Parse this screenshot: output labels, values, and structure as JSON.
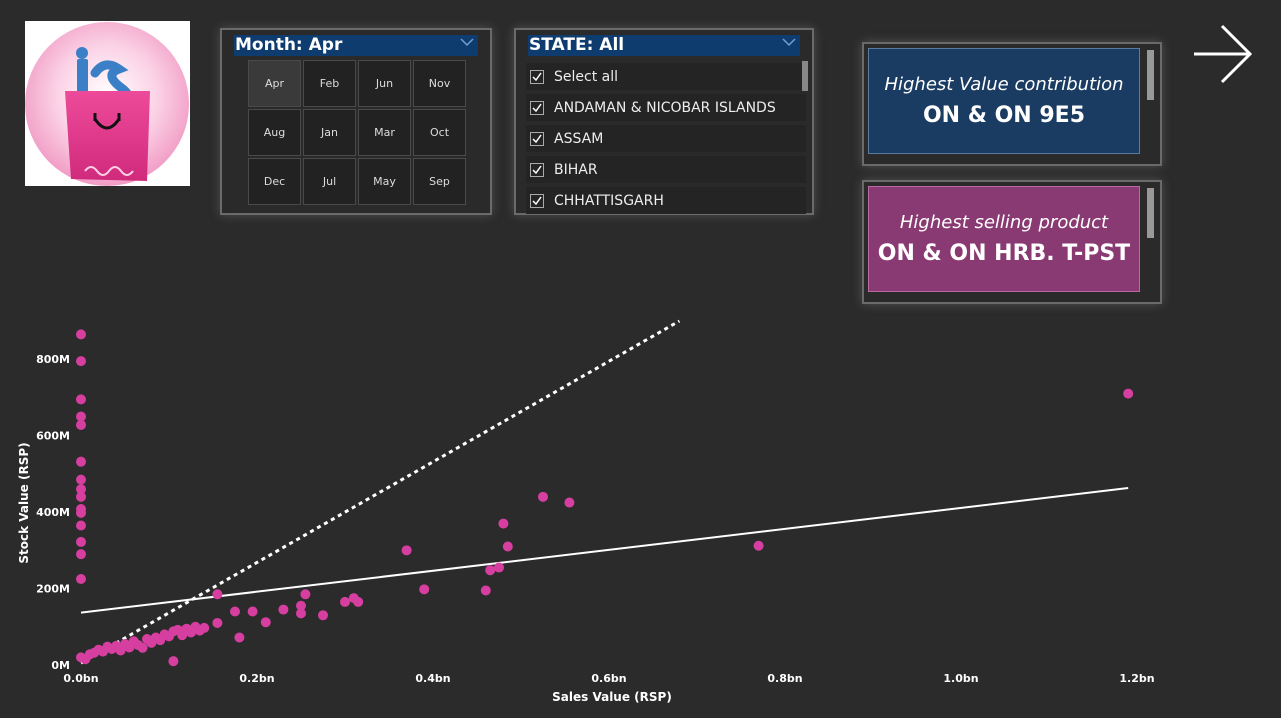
{
  "month_slicer": {
    "title": "Month: Apr",
    "months": [
      "Apr",
      "Feb",
      "Jun",
      "Nov",
      "Aug",
      "Jan",
      "Mar",
      "Oct",
      "Dec",
      "Jul",
      "May",
      "Sep"
    ],
    "selected": "Apr"
  },
  "state_slicer": {
    "title": "STATE: All",
    "items": [
      "Select all",
      "ANDAMAN & NICOBAR ISLANDS",
      "ASSAM",
      "BIHAR",
      "CHHATTISGARH"
    ]
  },
  "cards": {
    "value_title": "Highest Value contribution",
    "value_text": "ON & ON 9E5",
    "product_title": "Highest selling product",
    "product_text": "ON & ON HRB. T-PST"
  },
  "icons": {
    "logo": "shopping-bag-logo",
    "next": "arrow-right-icon",
    "dropdown": "chevron-down-icon",
    "check": "check-icon"
  },
  "colors": {
    "accent_blue": "#0f3c6e",
    "card_blue": "#1b3c62",
    "card_magenta": "#8a3a72",
    "point": "#d63fa0",
    "background": "#2b2b2b"
  },
  "chart_data": {
    "type": "scatter",
    "xlabel": "Sales Value (RSP)",
    "ylabel": "Stock Value (RSP)",
    "xlim": [
      0,
      1.2
    ],
    "ylim": [
      0,
      900
    ],
    "x_ticks": [
      0,
      0.2,
      0.4,
      0.6,
      0.8,
      1.0,
      1.2
    ],
    "x_tick_labels": [
      "0.0bn",
      "0.2bn",
      "0.4bn",
      "0.6bn",
      "0.8bn",
      "1.0bn",
      "1.2bn"
    ],
    "y_ticks": [
      0,
      200,
      400,
      600,
      800
    ],
    "y_tick_labels": [
      "0M",
      "200M",
      "400M",
      "600M",
      "800M"
    ],
    "grid": false,
    "points": [
      [
        0.0,
        865
      ],
      [
        0.0,
        795
      ],
      [
        0.0,
        695
      ],
      [
        0.0,
        650
      ],
      [
        0.0,
        628
      ],
      [
        0.0,
        532
      ],
      [
        0.0,
        485
      ],
      [
        0.0,
        460
      ],
      [
        0.0,
        440
      ],
      [
        0.0,
        408
      ],
      [
        0.0,
        398
      ],
      [
        0.0,
        365
      ],
      [
        0.0,
        322
      ],
      [
        0.0,
        290
      ],
      [
        0.0,
        225
      ],
      [
        0.0,
        20
      ],
      [
        0.005,
        15
      ],
      [
        0.01,
        28
      ],
      [
        0.015,
        32
      ],
      [
        0.02,
        40
      ],
      [
        0.025,
        35
      ],
      [
        0.03,
        48
      ],
      [
        0.035,
        42
      ],
      [
        0.04,
        50
      ],
      [
        0.045,
        38
      ],
      [
        0.05,
        55
      ],
      [
        0.055,
        46
      ],
      [
        0.06,
        62
      ],
      [
        0.065,
        52
      ],
      [
        0.07,
        45
      ],
      [
        0.075,
        68
      ],
      [
        0.08,
        58
      ],
      [
        0.085,
        72
      ],
      [
        0.09,
        65
      ],
      [
        0.095,
        80
      ],
      [
        0.1,
        75
      ],
      [
        0.105,
        88
      ],
      [
        0.11,
        92
      ],
      [
        0.115,
        78
      ],
      [
        0.12,
        95
      ],
      [
        0.125,
        85
      ],
      [
        0.13,
        100
      ],
      [
        0.135,
        90
      ],
      [
        0.14,
        97
      ],
      [
        0.105,
        10
      ],
      [
        0.155,
        110
      ],
      [
        0.155,
        185
      ],
      [
        0.175,
        140
      ],
      [
        0.18,
        72
      ],
      [
        0.195,
        140
      ],
      [
        0.21,
        112
      ],
      [
        0.23,
        145
      ],
      [
        0.25,
        135
      ],
      [
        0.25,
        155
      ],
      [
        0.255,
        185
      ],
      [
        0.275,
        130
      ],
      [
        0.3,
        165
      ],
      [
        0.31,
        175
      ],
      [
        0.315,
        165
      ],
      [
        0.37,
        300
      ],
      [
        0.39,
        198
      ],
      [
        0.46,
        195
      ],
      [
        0.465,
        248
      ],
      [
        0.475,
        255
      ],
      [
        0.48,
        370
      ],
      [
        0.485,
        310
      ],
      [
        0.525,
        440
      ],
      [
        0.555,
        425
      ],
      [
        0.77,
        312
      ],
      [
        1.19,
        710
      ]
    ],
    "trend_solid": [
      [
        0.0,
        137
      ],
      [
        1.19,
        463
      ]
    ],
    "trend_dotted": [
      [
        0.0,
        5
      ],
      [
        0.68,
        900
      ]
    ]
  }
}
